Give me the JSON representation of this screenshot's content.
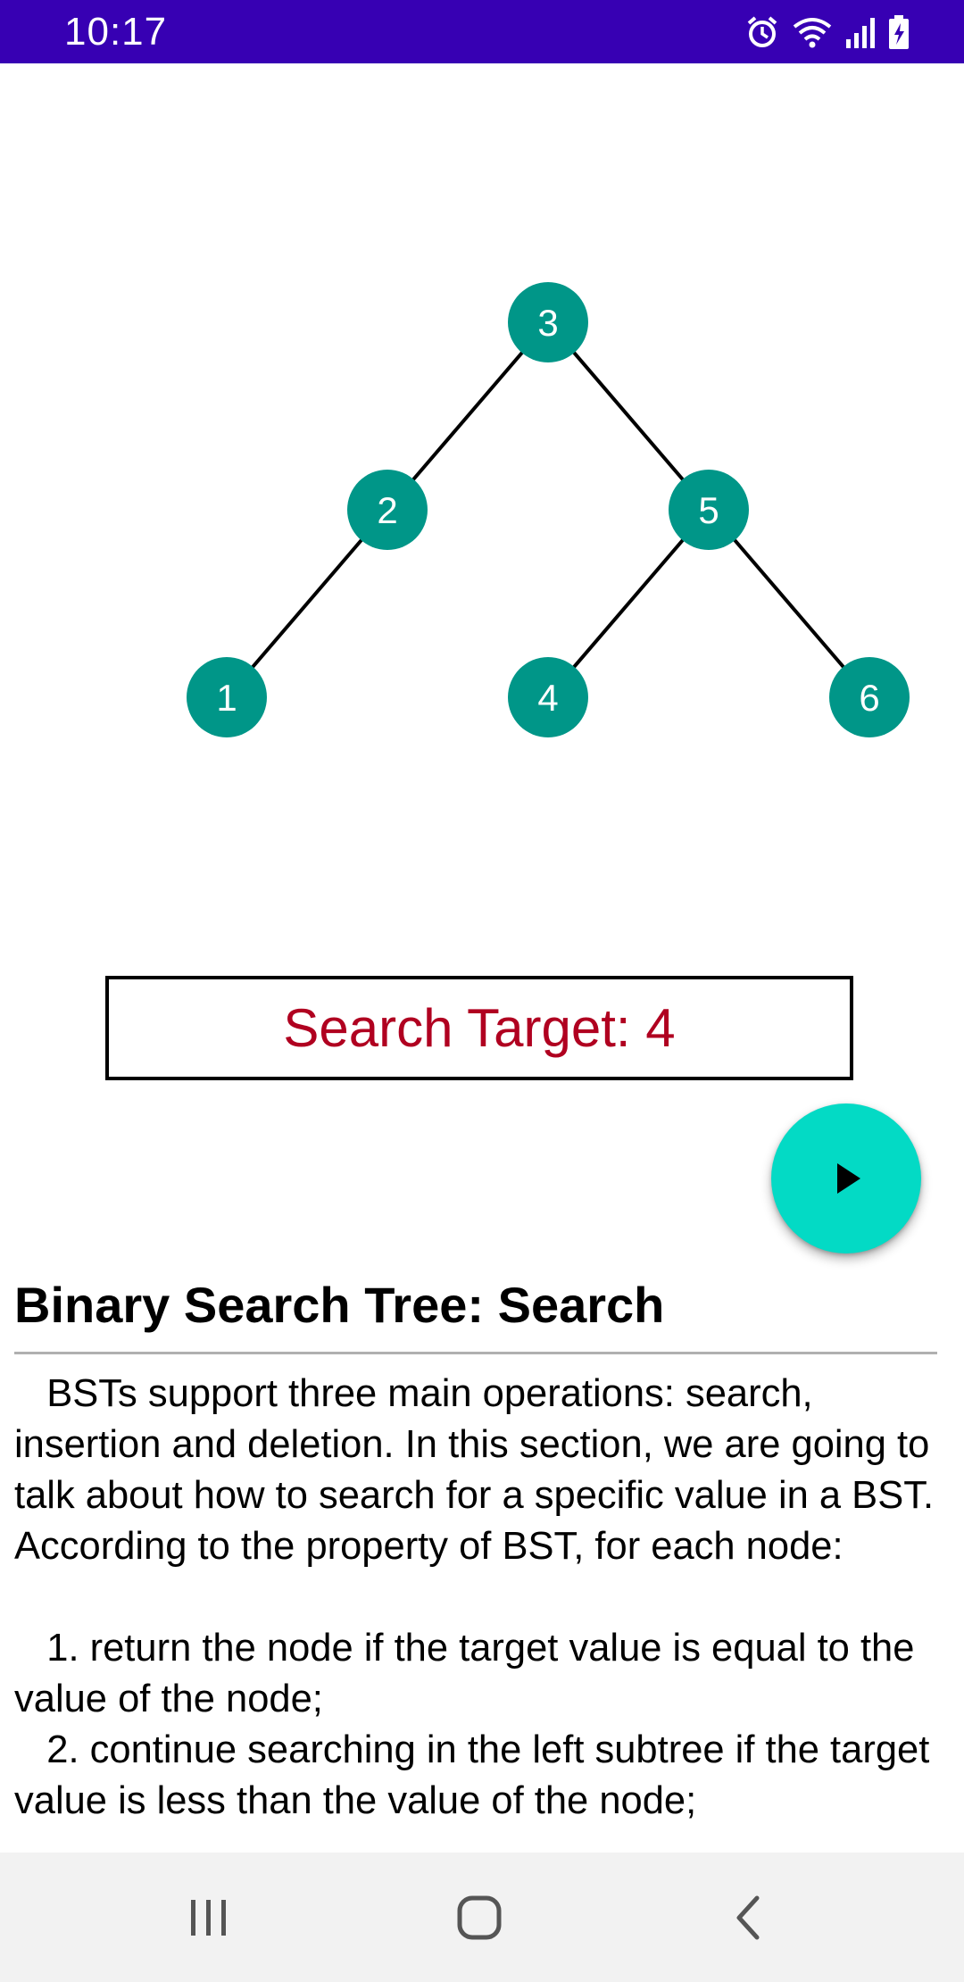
{
  "status_bar": {
    "time": "10:17",
    "icons": [
      "alarm-icon",
      "wifi-icon",
      "signal-icon",
      "battery-charging-icon"
    ],
    "background": "#3700b3"
  },
  "tree": {
    "node_color": "#009688",
    "edge_color": "#000000",
    "nodes": [
      {
        "id": "n3",
        "label": "3",
        "depth": 0,
        "order": 2
      },
      {
        "id": "n2",
        "label": "2",
        "depth": 1,
        "order": 1
      },
      {
        "id": "n5",
        "label": "5",
        "depth": 1,
        "order": 3
      },
      {
        "id": "n1",
        "label": "1",
        "depth": 2,
        "order": 0
      },
      {
        "id": "n4",
        "label": "4",
        "depth": 2,
        "order": 2
      },
      {
        "id": "n6",
        "label": "6",
        "depth": 2,
        "order": 4
      }
    ],
    "edges": [
      [
        "n3",
        "n2"
      ],
      [
        "n3",
        "n5"
      ],
      [
        "n2",
        "n1"
      ],
      [
        "n5",
        "n4"
      ],
      [
        "n5",
        "n6"
      ]
    ]
  },
  "search": {
    "label": "Search Target: 4",
    "color": "#b00020"
  },
  "fab": {
    "icon": "play-icon",
    "color": "#03dac5"
  },
  "doc": {
    "title": "Binary Search Tree: Search",
    "body": "   BSTs support three main operations: search, insertion and deletion. In this section, we are going to talk about how to search for a specific value in a BST. According to the property of BST, for each node:\n\n   1. return the node if the target value is equal to the value of the node;\n   2. continue searching in the left subtree if the target value is less than the value of the node;"
  },
  "nav_bar": {
    "icons": [
      "recent-apps-icon",
      "home-icon",
      "back-icon"
    ]
  }
}
